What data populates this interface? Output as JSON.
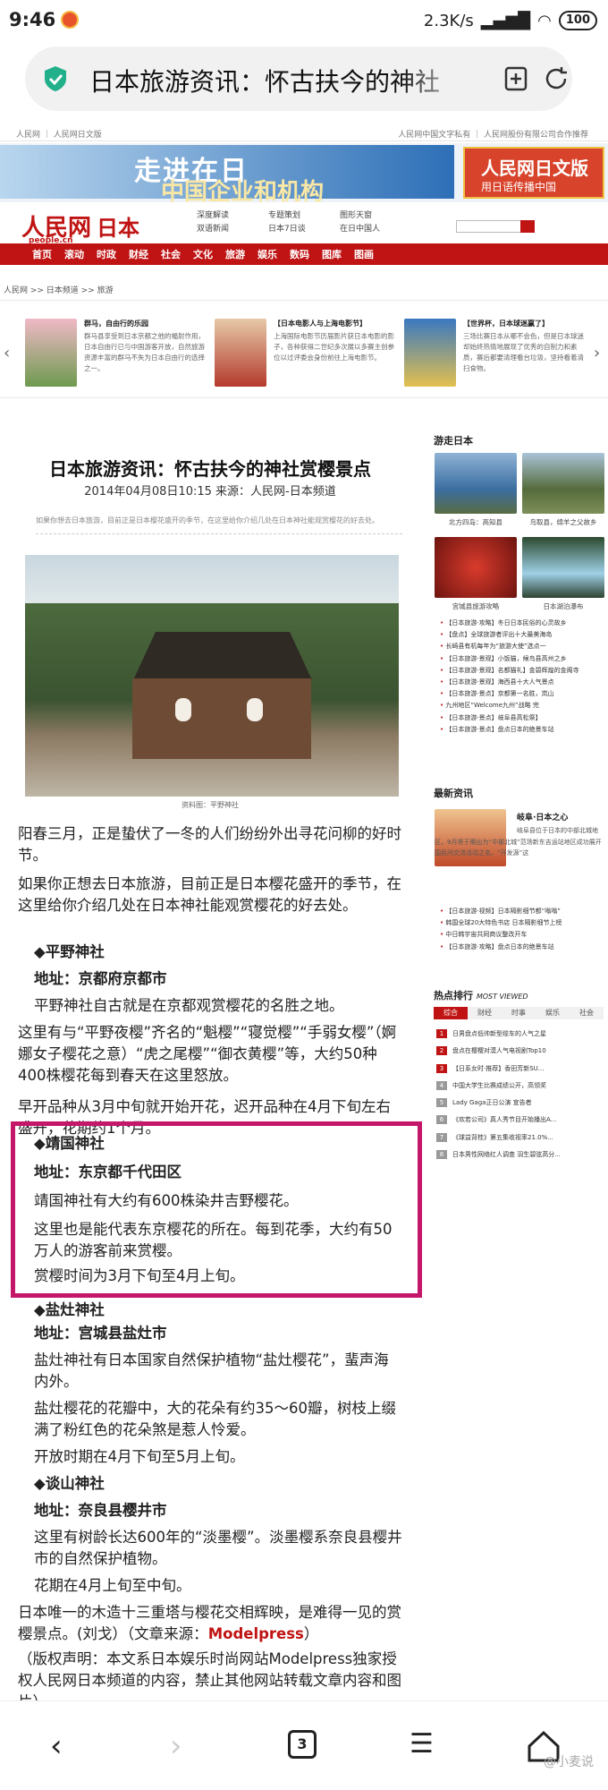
{
  "status_bar": {
    "time": "9:46",
    "network": "2.3K/s",
    "battery": "100"
  },
  "url_bar": {
    "title": "日本旅游资讯：怀古扶今的神社"
  },
  "site": {
    "top_links": "人民网 ｜ 人民网日文版",
    "top_right": "人民网中国文字私有 ｜ 人民网股份有限公司合作推荐",
    "banner_main": "走进在日",
    "banner_sub": "中国企业和机构",
    "banner_ad_title": "人民网日文版",
    "banner_ad_sub": "用日语传播中国",
    "logo": "人民网",
    "logo_section": "日本",
    "logo_domain": "people.cn",
    "nav_links": [
      "深度解读",
      "专题策划",
      "图形天窗",
      "双语新闻",
      "日本7日谈",
      "在日中国人"
    ],
    "menu": [
      "首页",
      "滚动",
      "时政",
      "财经",
      "社会",
      "文化",
      "旅游",
      "娱乐",
      "数码",
      "图库",
      "图画"
    ],
    "breadcrumb": "人民网 >> 日本频道 >> 旅游"
  },
  "slides": [
    {
      "title": "群马，自由行的乐园",
      "text": "群马县享受到日本京都之他的幅射作用，日本自由行已与中国游客开放，自然旅游资源丰富的群马不失为日本自由行的选择之一。"
    },
    {
      "title": "【日本电影人与上海电影节】",
      "text": "上海国际电影节历届影片获日本电影的影子，各种获得二世纪多次展以多赛主创参位以过评委会身份前往上海电影节。"
    },
    {
      "title": "【世界杯，日本球迷赢了】",
      "text": "三场比赛日本从哪不会色，但是日本球迷却始终热情地展现了优秀的自制力和素质，赛后都要清理看台垃圾，坚持看着清扫食物。"
    }
  ],
  "article": {
    "title": "日本旅游资讯：怀古扶今的神社赏樱景点",
    "date": "2014年04月08日10:15",
    "source": "来源：人民网-日本频道",
    "lead": "如果你想去日本旅游，目前正是日本樱花盛开的季节，在这里给你介绍几处在日本神社能观赏樱花的好去处。",
    "caption": "资料图：平野神社",
    "p1": "阳春三月，正是蛰伏了一冬的人们纷纷外出寻花问柳的好时节。",
    "p2": "如果你正想去日本旅游，目前正是日本樱花盛开的季节，在这里给你介绍几处在日本神社能观赏樱花的好去处。",
    "s1_title": "◆平野神社",
    "s1_addr": "地址：京都府京都市",
    "s1_p1": "平野神社自古就是在京都观赏樱花的名胜之地。",
    "s1_p2": "这里有与“平野夜樱”齐名的“魁樱”“寝觉樱”“手弱女樱”（婀娜女子樱花之意）“虎之尾樱”“御衣黄樱”等，大约50种400株樱花每到春天在这里怒放。",
    "s1_p3": "早开品种从3月中旬就开始开花，迟开品种在4月下旬左右盛开，花期约1个月。",
    "s2_title": "◆靖国神社",
    "s2_addr": "地址：东京都千代田区",
    "s2_p1": "靖国神社有大约有600株染井吉野樱花。",
    "s2_p2": "这里也是能代表东京樱花的所在。每到花季，大约有50万人的游客前来赏樱。",
    "s2_p3": "赏樱时间为3月下旬至4月上旬。",
    "s3_title": "◆盐灶神社",
    "s3_addr": "地址：宫城县盐灶市",
    "s3_p1": "盐灶神社有日本国家自然保护植物“盐灶樱花”，蜚声海内外。",
    "s3_p2": "盐灶樱花的花瓣中，大的花朵有约35～60瓣，树枝上缀满了粉红色的花朵煞是惹人怜爱。",
    "s3_p3": "开放时期在4月下旬至5月上旬。",
    "s4_title": "◆谈山神社",
    "s4_addr": "地址：奈良县樱井市",
    "s4_p1": "这里有树龄长达600年的“淡墨樱”。淡墨樱系奈良县樱井市的自然保护植物。",
    "s4_p2": "花期在4月上旬至中旬。",
    "s4_p3": "日本唯一的木造十三重塔与樱花交相辉映，是难得一见的赏樱景点。(刘戈）（文章来源：",
    "s4_source": "Modelpress",
    "s4_close": "）",
    "copyright": "（版权声明：本文系日本娱乐时尚网站Modelpress独家授权人民网日本频道的内容，禁止其他网站转载文章内容和图片）"
  },
  "sidebar": {
    "travel_heading": "游走日本",
    "thumbs": [
      "北方四岛：高知县",
      "鸟取县，绵羊之父故乡",
      "宫城县旅游攻略",
      "日本湖泊瀑布"
    ],
    "travel_list": [
      "【日本旅游·攻略】冬日日本民俗的心灵故乡",
      "【盘点】全球旅游者评出十大最美海岛",
      "长崎县有机每年为“旅游大使”选点一",
      "【日本旅游·景观】小饭猫，候鸟县高州之乡",
      "【日本旅游·景观】名都猫礼】金碧辉煌的金阁寺",
      "【日本旅游·景观】海西县十大人气景点",
      "【日本旅游·景点】京都第一名胜，岚山",
      "九州地区“Welcome九州”战略 完",
      "【日本旅游·景点】岐阜县高松祭】",
      "【日本旅游·景点】盘点日本的绝景车站"
    ],
    "news_heading": "最新资讯",
    "news_title": "岐阜·日本之心",
    "news_text": "岐阜县位于日本的中部北城地区，9月将于期出为“中部北城”范场新东吉运站地区成功展开国民间交流活动之名。“开发源”这",
    "news_list": [
      "【日本旅游·视频】日本隔影细节都“嗡嗡”",
      "韩国全球20大特色书店 日本隔影细节上榜",
      "中日韩宇宙共同商议整改开车",
      "【日本旅游·攻略】盘点日本的绝景车站"
    ],
    "hot_heading": "热点排行",
    "hot_heading_en": "MOST VIEWED",
    "hot_tabs": [
      "综合",
      "财经",
      "时事",
      "娱乐",
      "社会"
    ],
    "hot_list": [
      "日男盘点低帅新型缆车的人气之星",
      "盘点在樱樱对漠人气电视剧Top10",
      "【日系女时·推荐】香田芳新SU...",
      "中国大学生比赛成绩公开，高领奖",
      "Lady Gaga正日公演 宣告者",
      "《欢若公司》真人秀节目开始播出A...",
      "《球益背桂》第五集收视率21.0%...",
      "日本男性网络红人调查 羽生碧弦高分..."
    ]
  },
  "bottom_nav": {
    "tabs_count": "3",
    "watermark": "@小麦说"
  }
}
